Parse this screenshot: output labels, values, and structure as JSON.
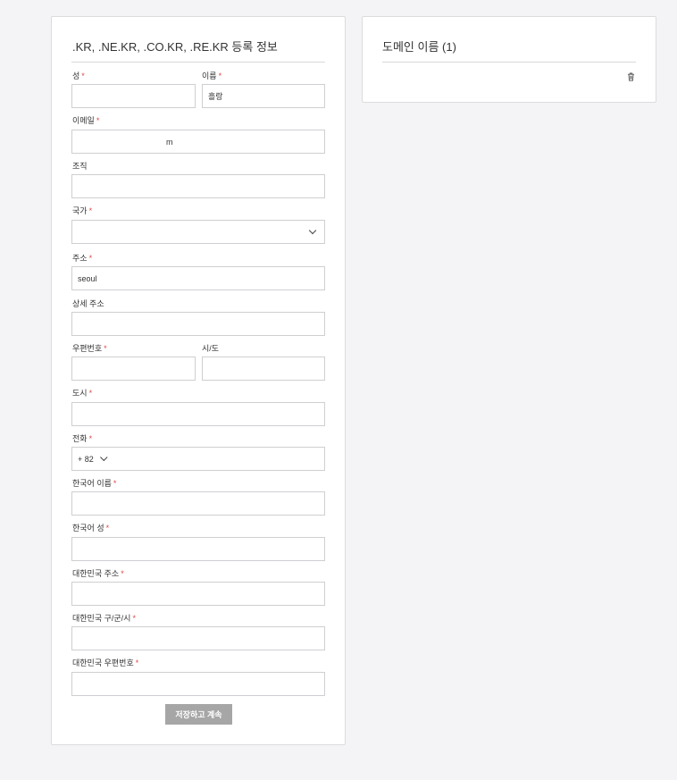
{
  "form": {
    "title": ".KR, .NE.KR, .CO.KR, .RE.KR 등록 정보",
    "required_mark": "*",
    "fields": {
      "last_name": {
        "label": "성",
        "value": ""
      },
      "first_name": {
        "label": "이름",
        "value": "흘랑"
      },
      "email": {
        "label": "이메일",
        "value": "m"
      },
      "organization": {
        "label": "조직",
        "value": ""
      },
      "country": {
        "label": "국가",
        "value": ""
      },
      "address": {
        "label": "주소",
        "value": "seoul"
      },
      "address_detail": {
        "label": "상세 주소",
        "value": ""
      },
      "postal_code": {
        "label": "우편번호",
        "value": ""
      },
      "state": {
        "label": "시/도",
        "value": ""
      },
      "city": {
        "label": "도시",
        "value": ""
      },
      "phone": {
        "label": "전화",
        "code": "+ 82",
        "value": ""
      },
      "korean_first_name": {
        "label": "한국어 이름",
        "value": ""
      },
      "korean_last_name": {
        "label": "한국어 성",
        "value": ""
      },
      "korean_address": {
        "label": "대한민국 주소",
        "value": ""
      },
      "korean_district": {
        "label": "대한민국 구/군/시",
        "value": ""
      },
      "korean_postal_code": {
        "label": "대한민국 우편번호",
        "value": ""
      }
    },
    "save_label": "저장하고 계속"
  },
  "domains": {
    "title": "도메인 이름 (1)"
  },
  "icons": {
    "select": "chevron-down-icon",
    "delete": "trash-icon"
  },
  "colors": {
    "required": "#e04848",
    "button_disabled": "#a6a6a6"
  }
}
